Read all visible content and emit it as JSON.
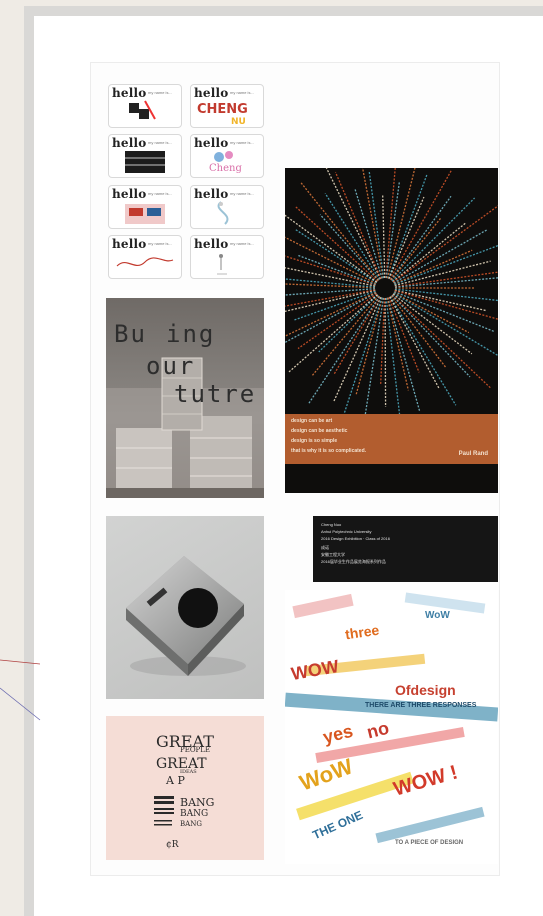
{
  "cards": [
    {
      "hello": "hello",
      "sub": "my name is...",
      "art": "crossword-art"
    },
    {
      "hello": "hello",
      "sub": "my name is...",
      "art": "cheng-nu-lettering"
    },
    {
      "hello": "hello",
      "sub": "my name is...",
      "art": "cheng-nu-block-letters"
    },
    {
      "hello": "hello",
      "sub": "my name is...",
      "art": "bubble-lettering"
    },
    {
      "hello": "hello",
      "sub": "my name is...",
      "art": "house-illustration"
    },
    {
      "hello": "hello",
      "sub": "my name is...",
      "art": "figure-sketch"
    },
    {
      "hello": "hello",
      "sub": "my name is...",
      "art": "signature-scribble"
    },
    {
      "hello": "hello",
      "sub": "my name is...",
      "art": "small-figure"
    }
  ],
  "poster_future": {
    "lines": [
      "Bu",
      "ing",
      "our",
      "tutre"
    ]
  },
  "poster_paul_rand": {
    "quote": [
      "design can be art",
      "design can be aesthetic",
      "design is so simple",
      "that is why it is so complicated."
    ],
    "author": "Paul Rand",
    "accent": "#b25d2f"
  },
  "info_card": {
    "lines": [
      "Cheng Nuo",
      "Anhui Polytechnic University",
      "2016 Design Exhibition · Class of 2016",
      "成诺",
      "安徽工程大学",
      "2016届毕业生作品展览海报系列作品"
    ]
  },
  "poster_wow": {
    "words": [
      "WoW",
      "three",
      "WOW",
      "Ofdesign",
      "THERE ARE THREE RESPONSES",
      "yes",
      "no",
      "WoW",
      "WOW !",
      "THE ONE",
      "TO A PIECE OF DESIGN"
    ]
  },
  "poster_great": {
    "lines": [
      "GREAT",
      "PEOPLE",
      "GREAT",
      "IDEAS",
      "A P",
      "BANG",
      "BANG",
      "BANG",
      "¢R"
    ]
  }
}
